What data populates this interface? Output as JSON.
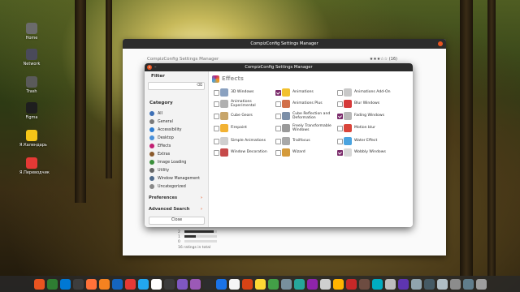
{
  "desktop": {
    "icons": [
      {
        "label": "Home",
        "color": "#6b6b6b"
      },
      {
        "label": "Network",
        "color": "#4a4a5a"
      },
      {
        "label": "Trash",
        "color": "#5a5a5a"
      },
      {
        "label": "Figma",
        "color": "#1e1e1e"
      },
      {
        "label": "Я.Календарь",
        "color": "#f5c518"
      },
      {
        "label": "Я.Переводчик",
        "color": "#e53935"
      }
    ]
  },
  "back_window": {
    "title": "CompizConfig Settings Manager",
    "subtitle": "CompizConfig Settings Manager",
    "stars": "★★★☆☆ (16)",
    "rating_rows": [
      {
        "label": "2",
        "fill": 0.9
      },
      {
        "label": "1",
        "fill": 0.35
      },
      {
        "label": "0",
        "fill": 0.0
      }
    ],
    "total": "16 ratings in total"
  },
  "dialog": {
    "title": "CompizConfig Settings Manager",
    "filter_heading": "Filter",
    "filter_value": "",
    "category_heading": "Category",
    "categories": [
      {
        "label": "All",
        "color": "#3d6fb5"
      },
      {
        "label": "General",
        "color": "#7a7a7a"
      },
      {
        "label": "Accessibility",
        "color": "#2d7dd2"
      },
      {
        "label": "Desktop",
        "color": "#4a90d9"
      },
      {
        "label": "Effects",
        "color": "#c21f72"
      },
      {
        "label": "Extras",
        "color": "#8a5a2b"
      },
      {
        "label": "Image Loading",
        "color": "#3a8f3a"
      },
      {
        "label": "Utility",
        "color": "#666666"
      },
      {
        "label": "Window Management",
        "color": "#4f6a8a"
      },
      {
        "label": "Uncategorized",
        "color": "#888888"
      }
    ],
    "preferences_label": "Preferences",
    "advanced_search_label": "Advanced Search",
    "close_label": "Close",
    "section_title": "Effects",
    "plugins": [
      [
        {
          "label": "3D Windows",
          "checked": false,
          "color": "#8aa1c0"
        },
        {
          "label": "Animations Experimental",
          "checked": false,
          "color": "#b0b0b0"
        },
        {
          "label": "Cube Gears",
          "checked": false,
          "color": "#c7a56a"
        },
        {
          "label": "Firepaint",
          "checked": false,
          "color": "#f2b233"
        },
        {
          "label": "Simple Animations",
          "checked": false,
          "color": "#cfcfcf"
        },
        {
          "label": "Window Decoration",
          "checked": false,
          "color": "#c64a4a"
        }
      ],
      [
        {
          "label": "Animations",
          "checked": true,
          "color": "#f2c12e"
        },
        {
          "label": "Animations Plus",
          "checked": false,
          "color": "#d1704a"
        },
        {
          "label": "Cube Reflection and Deformation",
          "checked": false,
          "color": "#7c8fa8"
        },
        {
          "label": "Freely Transformable Windows",
          "checked": false,
          "color": "#9a9a9a"
        },
        {
          "label": "Trailfocus",
          "checked": false,
          "color": "#a8a8a8"
        },
        {
          "label": "Wizard",
          "checked": false,
          "color": "#d49a3a"
        }
      ],
      [
        {
          "label": "Animations Add-On",
          "checked": false,
          "color": "#c8c8c8"
        },
        {
          "label": "Blur Windows",
          "checked": false,
          "color": "#d63a3a"
        },
        {
          "label": "Fading Windows",
          "checked": true,
          "color": "#b8b8b8"
        },
        {
          "label": "Motion blur",
          "checked": false,
          "color": "#d9443a"
        },
        {
          "label": "Water Effect",
          "checked": false,
          "color": "#4aa3df"
        },
        {
          "label": "Wobbly Windows",
          "checked": true,
          "color": "#d8d8d8"
        }
      ]
    ]
  },
  "dock": {
    "icons": [
      "#e95420",
      "#2e7d32",
      "#0078d4",
      "#3d3d3d",
      "#ff7139",
      "#f58220",
      "#1565c0",
      "#e53935",
      "#22a7f0",
      "#ffffff",
      "#3b3b3b",
      "#7e57c2",
      "#9b59b6",
      "#2d2d2d",
      "#1a73e8",
      "#f5f5f5",
      "#d84315",
      "#fdd835",
      "#43a047",
      "#78909c",
      "#26a69a",
      "#8e24aa",
      "#cfcfcf",
      "#ffb300",
      "#c62828",
      "#6d4c41",
      "#00acc1",
      "#bdbdbd",
      "#5e35b1",
      "#90a4ae",
      "#455a64",
      "#b0bec5",
      "#8c8c8c",
      "#607d8b",
      "#9e9e9e"
    ]
  }
}
